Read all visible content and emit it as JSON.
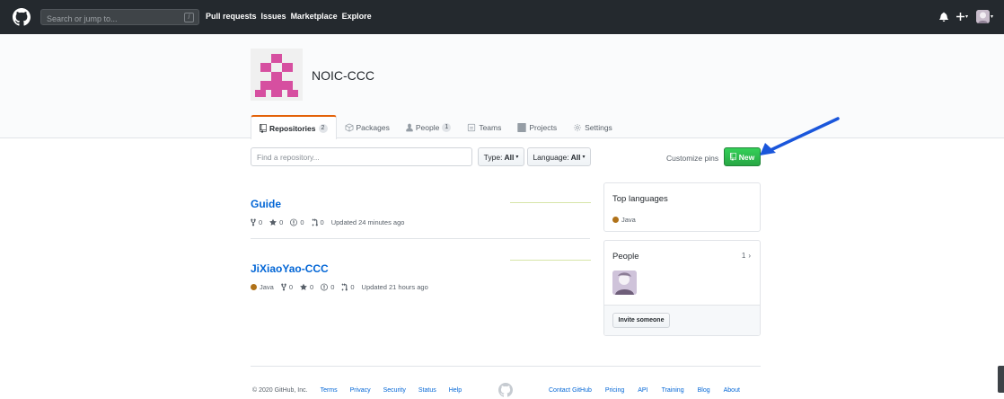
{
  "header": {
    "search_placeholder": "Search or jump to...",
    "slash_key": "/",
    "nav": [
      "Pull requests",
      "Issues",
      "Marketplace",
      "Explore"
    ],
    "caret": "▾"
  },
  "org": {
    "name": "NOIC-CCC"
  },
  "tabs": [
    {
      "label": "Repositories",
      "count": "2",
      "selected": true,
      "icon": "repo-icon"
    },
    {
      "label": "Packages",
      "count": "",
      "selected": false,
      "icon": "package-icon"
    },
    {
      "label": "People",
      "count": "1",
      "selected": false,
      "icon": "person-icon"
    },
    {
      "label": "Teams",
      "count": "",
      "selected": false,
      "icon": "team-icon"
    },
    {
      "label": "Projects",
      "count": "",
      "selected": false,
      "icon": "project-icon"
    },
    {
      "label": "Settings",
      "count": "",
      "selected": false,
      "icon": "gear-icon"
    }
  ],
  "filter": {
    "placeholder": "Find a repository...",
    "type_label": "Type:",
    "type_value": "All",
    "language_label": "Language:",
    "language_value": "All",
    "customize_pins": "Customize pins",
    "new_label": "New"
  },
  "repos": [
    {
      "name": "Guide",
      "language": "",
      "forks": "0",
      "stars": "0",
      "issues": "0",
      "pulls": "0",
      "updated": "Updated 24 minutes ago"
    },
    {
      "name": "JiXiaoYao-CCC",
      "language": "Java",
      "forks": "0",
      "stars": "0",
      "issues": "0",
      "pulls": "0",
      "updated": "Updated 21 hours ago"
    }
  ],
  "sidebar": {
    "top_languages_title": "Top languages",
    "top_language": "Java",
    "people_title": "People",
    "people_count": "1",
    "people_chevron": "›",
    "invite_label": "Invite someone"
  },
  "footer": {
    "copyright": "© 2020 GitHub, Inc.",
    "left_links": [
      "Terms",
      "Privacy",
      "Security",
      "Status",
      "Help"
    ],
    "right_links": [
      "Contact GitHub",
      "Pricing",
      "API",
      "Training",
      "Blog",
      "About"
    ]
  },
  "colors": {
    "header_bg": "#24292e",
    "link": "#0366d6",
    "new_button": "#28a745",
    "java": "#b07219",
    "tab_accent": "#e36209",
    "arrow": "#1a56db"
  }
}
